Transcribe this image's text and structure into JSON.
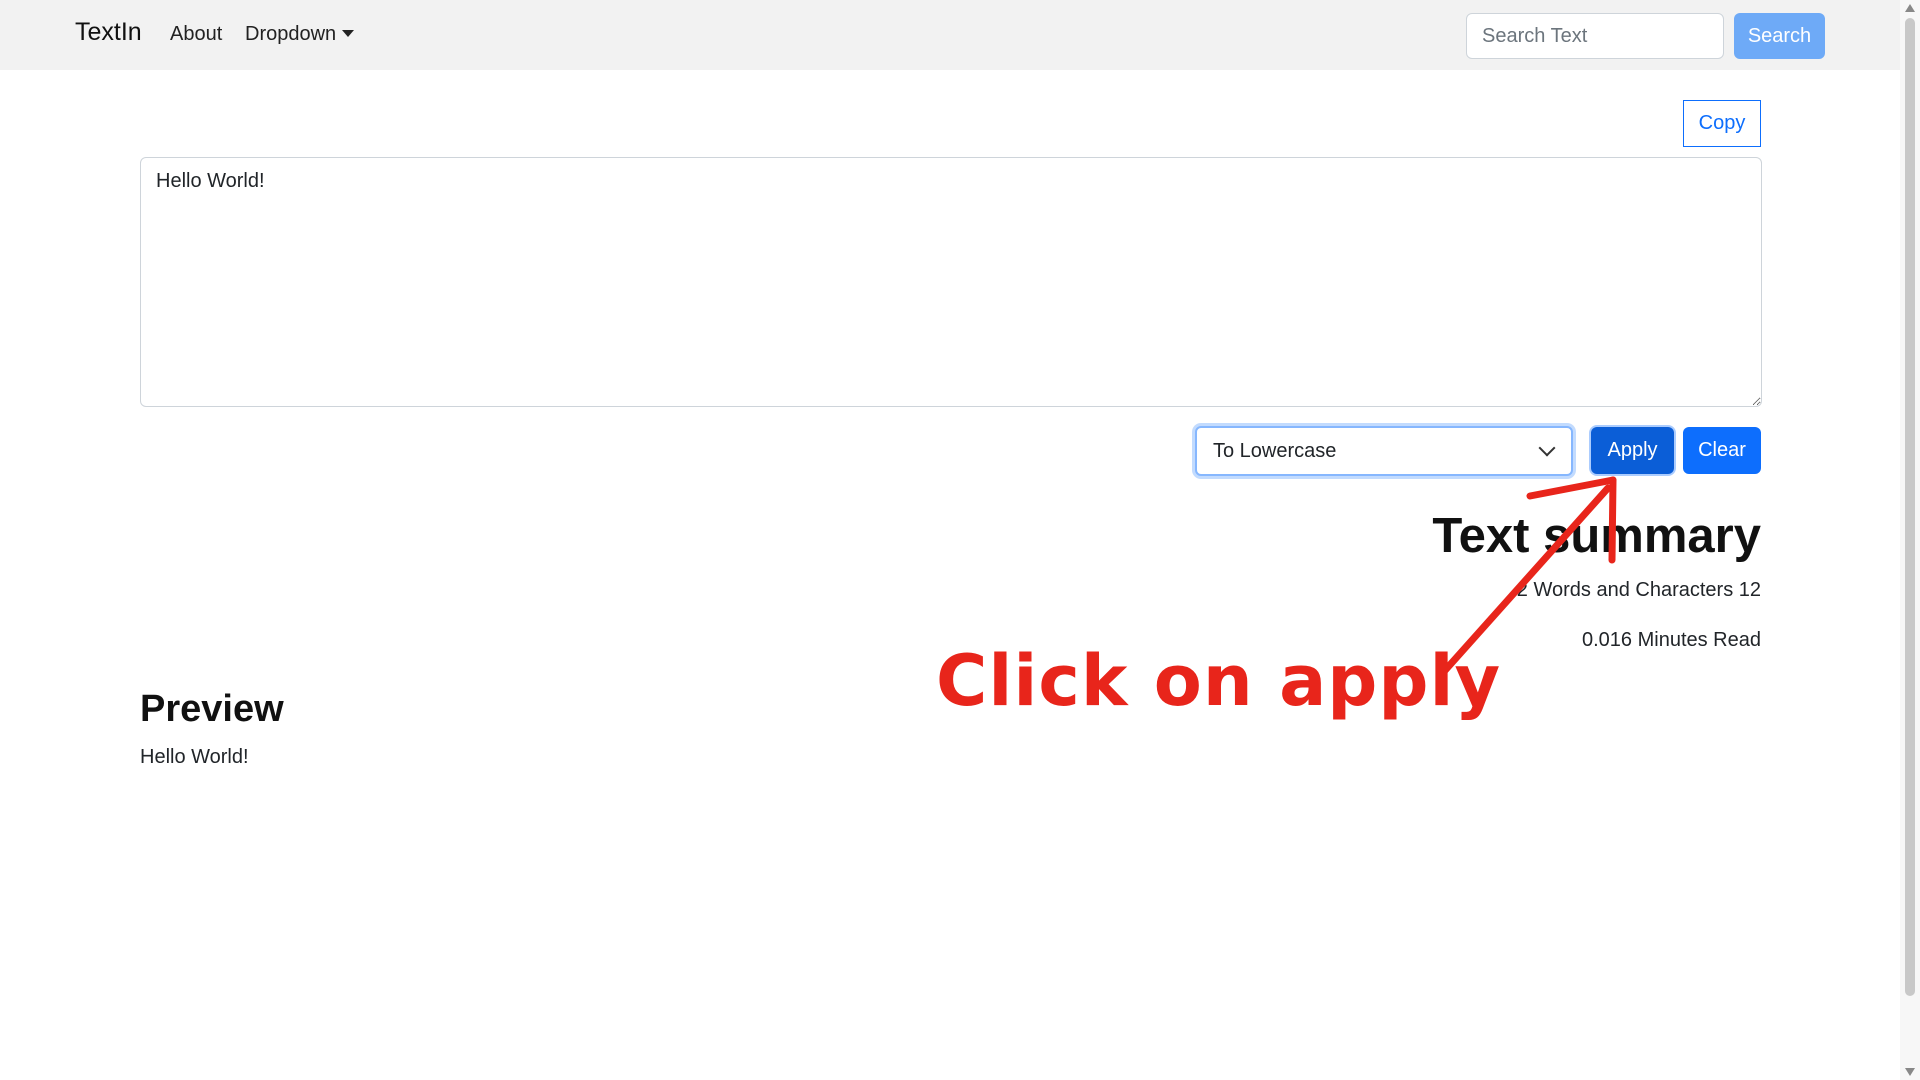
{
  "navbar": {
    "brand": "TextIn",
    "links": [
      {
        "label": "About"
      },
      {
        "label": "Dropdown"
      }
    ],
    "search": {
      "placeholder": "Search Text",
      "value": "",
      "button_label": "Search"
    }
  },
  "editor": {
    "copy_label": "Copy",
    "text_value": "Hello World!",
    "operation_selected": "To Lowercase",
    "apply_label": "Apply",
    "clear_label": "Clear"
  },
  "summary": {
    "title": "Text summary",
    "words_line": "2 Words and Characters 12",
    "read_time_line": "0.016 Minutes Read"
  },
  "preview": {
    "title": "Preview",
    "text": "Hello World!"
  },
  "annotation": {
    "text": "Click on apply",
    "color": "#e8251b"
  },
  "colors": {
    "primary": "#0d6efd",
    "primary_focus": "#0b5ed7",
    "search_button": "#6eaaf7",
    "navbar_bg": "#f2f2f2"
  }
}
